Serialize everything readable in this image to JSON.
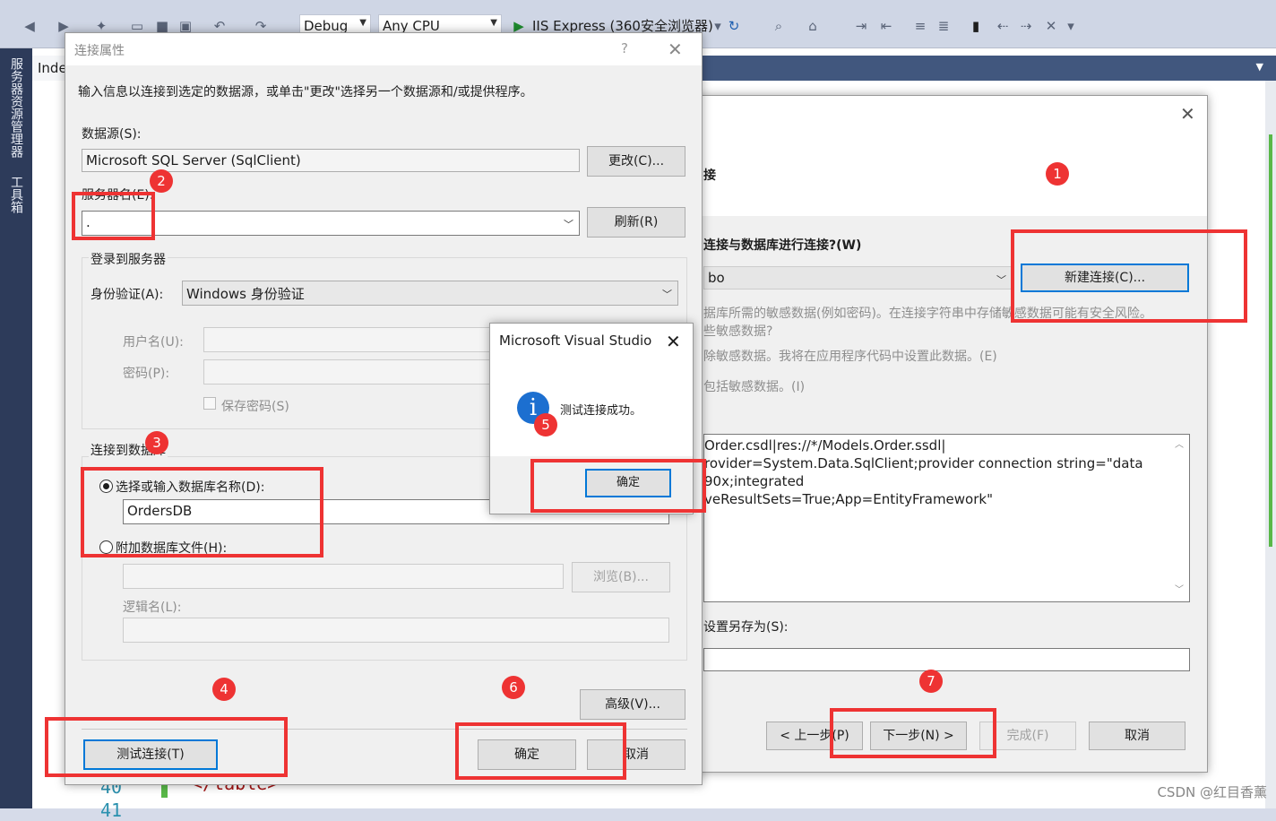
{
  "toolbar": {
    "config": "Debug",
    "platform": "Any CPU",
    "run_target": "IIS Express (360安全浏览器)"
  },
  "side_tabs": [
    "服务器资源管理器",
    "工具箱"
  ],
  "editor": {
    "doc_tab": "Inde",
    "line_numbers": [
      "40",
      "41"
    ],
    "code_fragment": "</table>"
  },
  "wizard": {
    "heading_fragment": "接",
    "question": "连接与数据库进行连接?(W)",
    "connection_value": "bo",
    "new_connection_btn": "新建连接(C)...",
    "sensitive_text_1": "据库所需的敏感数据(例如密码)。在连接字符串中存储敏感数据可能有安全风险。",
    "sensitive_text_2": "些敏感数据?",
    "option_exclude": "除敏感数据。我将在应用程序代码中设置此数据。(E)",
    "option_include": "包括敏感数据。(I)",
    "conn_string_lines": [
      "Order.csdl|res://*/Models.Order.ssdl|",
      "rovider=System.Data.SqlClient;provider connection string=\"data",
      "90x;integrated",
      "veResultSets=True;App=EntityFramework\""
    ],
    "save_as_label": "设置另存为(S):",
    "buttons": {
      "prev": "< 上一步(P)",
      "next": "下一步(N) >",
      "finish": "完成(F)",
      "cancel": "取消"
    }
  },
  "conn_dialog": {
    "title": "连接属性",
    "help": "?",
    "intro": "输入信息以连接到选定的数据源，或单击\"更改\"选择另一个数据源和/或提供程序。",
    "datasource_label": "数据源(S):",
    "datasource_value": "Microsoft SQL Server (SqlClient)",
    "change_btn": "更改(C)...",
    "server_label": "服务器名(E):",
    "server_value": ".",
    "refresh_btn": "刷新(R)",
    "login_group": "登录到服务器",
    "auth_label": "身份验证(A):",
    "auth_value": "Windows 身份验证",
    "username_label": "用户名(U):",
    "password_label": "密码(P):",
    "save_password": "保存密码(S)",
    "db_group": "连接到数据库",
    "select_db_label": "选择或输入数据库名称(D):",
    "db_value": "OrdersDB",
    "attach_label": "附加数据库文件(H):",
    "browse_btn": "浏览(B)...",
    "logical_label": "逻辑名(L):",
    "advanced_btn": "高级(V)...",
    "test_btn": "测试连接(T)",
    "ok_btn": "确定",
    "cancel_btn": "取消"
  },
  "msgbox": {
    "title": "Microsoft Visual Studio",
    "message": "测试连接成功。",
    "ok": "确定",
    "icon": "info-icon"
  },
  "badges": [
    "1",
    "2",
    "3",
    "4",
    "5",
    "6",
    "7"
  ],
  "watermark": "CSDN @红目香薰",
  "colors": {
    "annotation_red": "#ee3333",
    "focus_blue": "#0078d7"
  }
}
